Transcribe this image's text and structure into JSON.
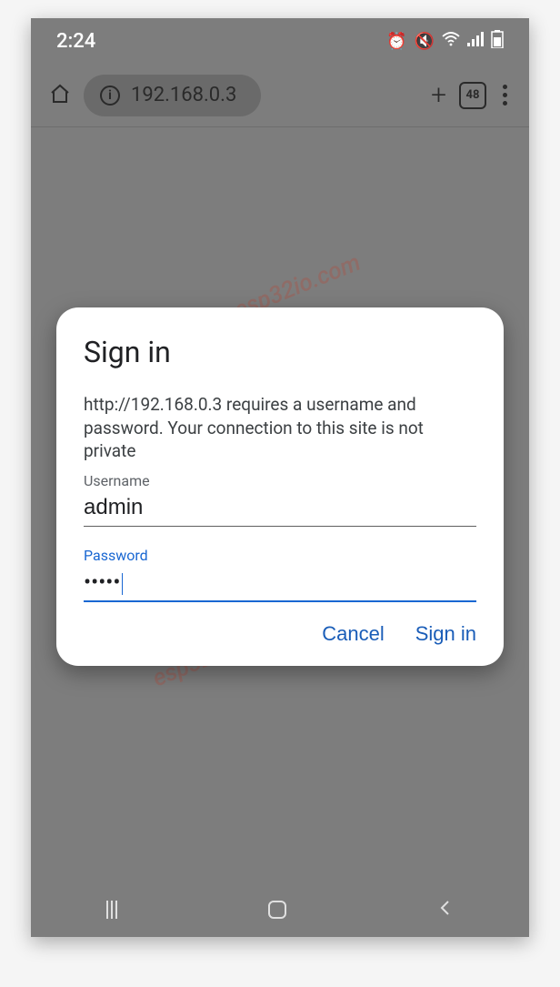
{
  "status": {
    "time": "2:24",
    "icons": {
      "alarm": "alarm-icon",
      "mute": "mute-icon",
      "wifi": "wifi-icon",
      "signal": "signal-icon",
      "battery": "battery-icon"
    }
  },
  "browser": {
    "url": "192.168.0.3",
    "tab_count": "48"
  },
  "dialog": {
    "title": "Sign in",
    "message": "http://192.168.0.3 requires a username and password. Your connection to this site is not private",
    "username_label": "Username",
    "username_value": "admin",
    "password_label": "Password",
    "password_value": "•••••",
    "cancel_label": "Cancel",
    "signin_label": "Sign in"
  },
  "watermark": "esp32io.com"
}
